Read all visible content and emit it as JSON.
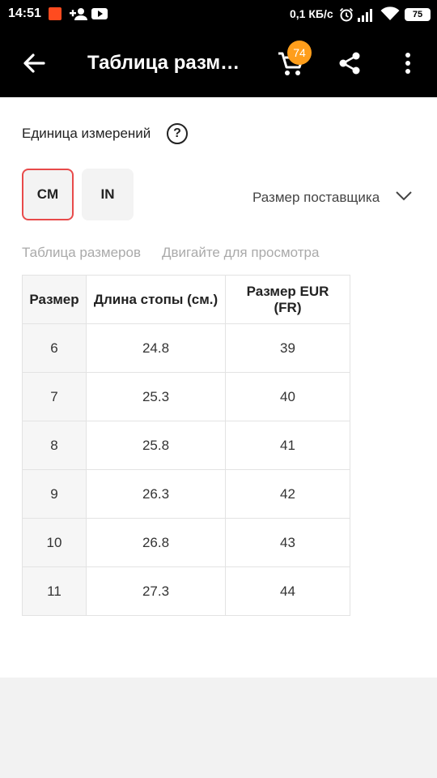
{
  "status_bar": {
    "time": "14:51",
    "network_speed": "0,1 КБ/с",
    "battery": "75",
    "icons": [
      "aliexpress-notification-icon",
      "add-person-icon",
      "youtube-icon",
      "alarm-icon",
      "signal-icon",
      "wifi-icon",
      "battery-icon"
    ]
  },
  "app_bar": {
    "title": "Таблица размеров",
    "cart_count": "74",
    "background": "#000000",
    "badge_color": "#ff9e1b"
  },
  "units": {
    "label": "Единица измерений",
    "options": [
      "CM",
      "IN"
    ],
    "selected": "CM",
    "active_border_color": "#e84a4a"
  },
  "supplier_size": {
    "label": "Размер поставщика"
  },
  "size_table": {
    "title": "Таблица размеров",
    "hint": "Двигайте для просмотра",
    "headers": [
      "Размер",
      "Длина стопы (см.)",
      "Размер EUR (FR)"
    ],
    "rows": [
      [
        "6",
        "24.8",
        "39"
      ],
      [
        "7",
        "25.3",
        "40"
      ],
      [
        "8",
        "25.8",
        "41"
      ],
      [
        "9",
        "26.3",
        "42"
      ],
      [
        "10",
        "26.8",
        "43"
      ],
      [
        "11",
        "27.3",
        "44"
      ]
    ]
  }
}
